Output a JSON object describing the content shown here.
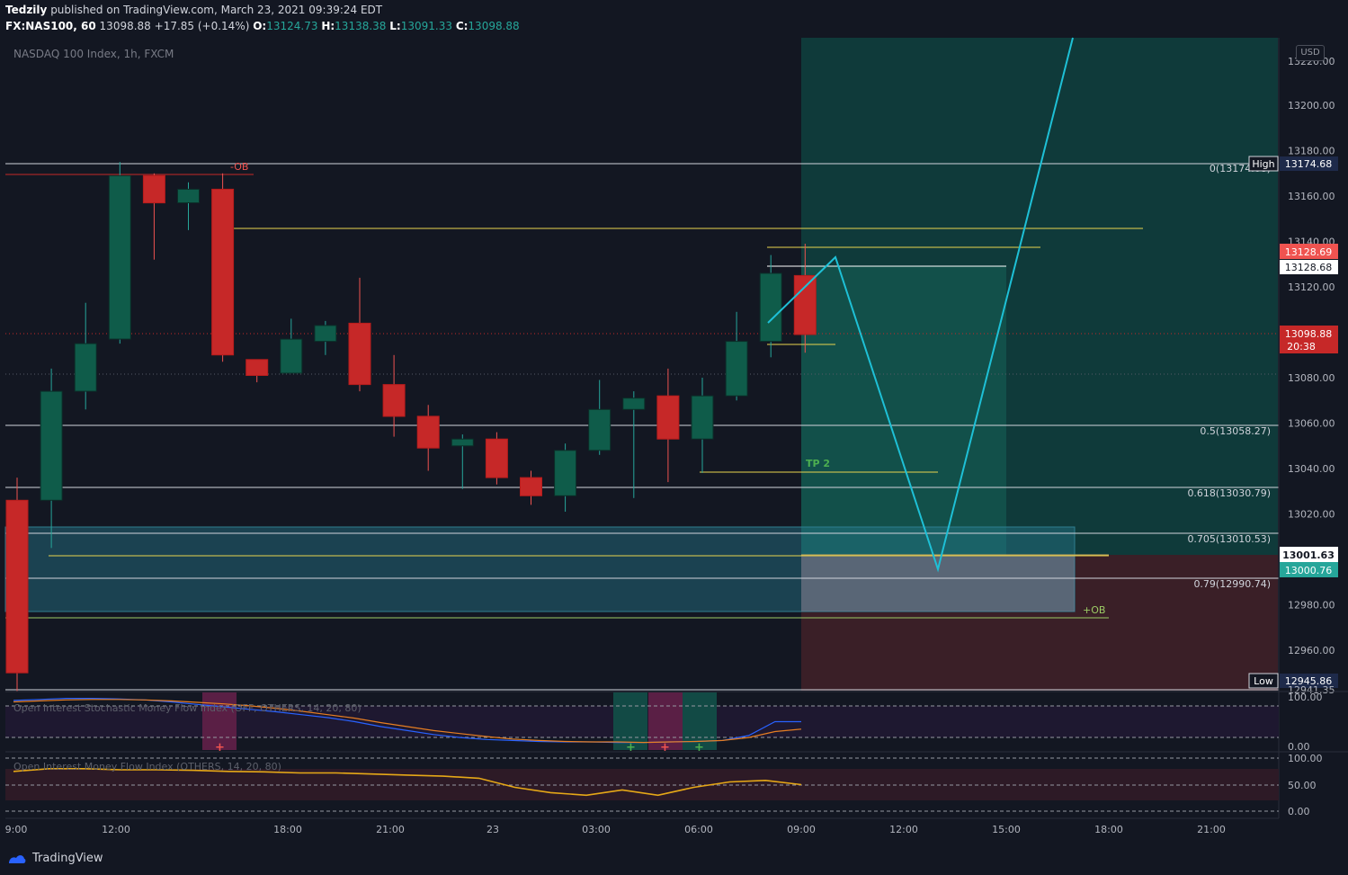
{
  "header": {
    "author": "Tedzily",
    "published_text": "published on TradingView.com, March 23, 2021 09:39:24 EDT",
    "symbol": "FX:NAS100, 60",
    "last": "13098.88",
    "change": "+17.85 (+0.14%)",
    "o_label": "O:",
    "o": "13124.73",
    "h_label": "H:",
    "h": "13138.38",
    "l_label": "L:",
    "l": "13091.33",
    "c_label": "C:",
    "c": "13098.88"
  },
  "legend": {
    "title": "NASDAQ 100 Index, 1h, FXCM"
  },
  "currency_button": "USD",
  "price_axis": {
    "ticks": [
      "13200.00",
      "13180.00",
      "13160.00",
      "13140.00",
      "13120.00",
      "13080.00",
      "13060.00",
      "13040.00",
      "13020.00",
      "12980.00",
      "12960.00"
    ],
    "top_partial": "13220.00",
    "bottom_partial": "12941.35"
  },
  "price_tags": {
    "high_label": "High",
    "high_value": "13174.68",
    "red_tag": "13128.69",
    "white_tag": "13128.68",
    "current": "13098.88",
    "countdown": "20:38",
    "tag_13001": "13001.63",
    "tag_13000": "13000.76",
    "low_label": "Low",
    "low_value": "12945.86"
  },
  "fib_labels": {
    "f0": "0(13174.68)",
    "f05": "0.5(13058.27)",
    "f0618": "0.618(13030.79)",
    "f0705": "0.705(13010.53)",
    "f079": "0.79(12990.74)"
  },
  "annotations": {
    "minus_ob": "-OB",
    "plus_ob": "+OB",
    "tp2": "TP 2"
  },
  "indicators": {
    "ind1_title": "Open Interest Stochastic Money Flow Index (OFF, OTHERS, 14, 20, 80)",
    "ind1_ticks": [
      "100.00",
      "0.00"
    ],
    "ind2_title": "Open Interest Money Flow Index (OTHERS, 14, 20, 80)",
    "ind2_ticks": [
      "100.00",
      "50.00",
      "0.00"
    ]
  },
  "time_axis": [
    "9:00",
    "12:00",
    "18:00",
    "21:00",
    "23",
    "03:00",
    "06:00",
    "09:00",
    "12:00",
    "15:00",
    "18:00",
    "21:00"
  ],
  "footer": {
    "brand": "TradingView"
  },
  "colors": {
    "background": "#131722",
    "bull": "#0f5c4a",
    "bear": "#c62828",
    "cyan": "#1ec0d6",
    "yellow": "#e8d44d",
    "target_zone": "#0f3a3a",
    "stop_zone": "#3a1f27"
  },
  "chart_data": {
    "type": "candlestick",
    "title": "NASDAQ 100 Index, 1h, FXCM",
    "ylim": [
      12941.35,
      13226
    ],
    "candles": [
      {
        "o": 13026,
        "h": 13036,
        "l": 12942,
        "c": 12950
      },
      {
        "o": 13026,
        "h": 13084,
        "l": 13005,
        "c": 13074
      },
      {
        "o": 13074,
        "h": 13113,
        "l": 13066,
        "c": 13095
      },
      {
        "o": 13097,
        "h": 13175,
        "l": 13095,
        "c": 13169
      },
      {
        "o": 13169,
        "h": 13170,
        "l": 13132,
        "c": 13157
      },
      {
        "o": 13157,
        "h": 13166,
        "l": 13145,
        "c": 13163
      },
      {
        "o": 13163,
        "h": 13170,
        "l": 13087,
        "c": 13090
      },
      {
        "o": 13088,
        "h": 13086,
        "l": 13078,
        "c": 13081
      },
      {
        "o": 13082,
        "h": 13106,
        "l": 13082,
        "c": 13097
      },
      {
        "o": 13096,
        "h": 13105,
        "l": 13090,
        "c": 13103
      },
      {
        "o": 13104,
        "h": 13124,
        "l": 13074,
        "c": 13077
      },
      {
        "o": 13077,
        "h": 13090,
        "l": 13054,
        "c": 13063
      },
      {
        "o": 13063,
        "h": 13068,
        "l": 13039,
        "c": 13049
      },
      {
        "o": 13050,
        "h": 13055,
        "l": 13031,
        "c": 13053
      },
      {
        "o": 13053,
        "h": 13056,
        "l": 13033,
        "c": 13036
      },
      {
        "o": 13036,
        "h": 13039,
        "l": 13024,
        "c": 13028
      },
      {
        "o": 13028,
        "h": 13051,
        "l": 13021,
        "c": 13048
      },
      {
        "o": 13048,
        "h": 13079,
        "l": 13046,
        "c": 13066
      },
      {
        "o": 13066,
        "h": 13074,
        "l": 13027,
        "c": 13071
      },
      {
        "o": 13072,
        "h": 13084,
        "l": 13034,
        "c": 13053
      },
      {
        "o": 13053,
        "h": 13080,
        "l": 13038,
        "c": 13072
      },
      {
        "o": 13072,
        "h": 13109,
        "l": 13070,
        "c": 13096
      },
      {
        "o": 13096,
        "h": 13134,
        "l": 13089,
        "c": 13126
      },
      {
        "o": 13125,
        "h": 13139,
        "l": 13091,
        "c": 13099
      }
    ],
    "fib_levels": [
      {
        "ratio": "0",
        "price": 13174.68
      },
      {
        "ratio": "0.5",
        "price": 13058.27
      },
      {
        "ratio": "0.618",
        "price": 13030.79
      },
      {
        "ratio": "0.705",
        "price": 13010.53
      },
      {
        "ratio": "0.79",
        "price": 12990.74
      }
    ],
    "projection_path": [
      [
        13105
      ],
      [
        13132
      ],
      [
        12997
      ],
      [
        13226
      ]
    ],
    "stoch_mfi": [
      93,
      95,
      97,
      97,
      96,
      94,
      90,
      85,
      80,
      75,
      70,
      64,
      58,
      50,
      40,
      32,
      24,
      18,
      14,
      12,
      10,
      9,
      9,
      8,
      8,
      9,
      10,
      12,
      22,
      50,
      50
    ],
    "stoch_signal": [
      90,
      92,
      94,
      95,
      95,
      94,
      92,
      89,
      86,
      82,
      77,
      71,
      64,
      57,
      48,
      40,
      32,
      26,
      20,
      15,
      12,
      10,
      9,
      9,
      8,
      9,
      10,
      12,
      18,
      30,
      35
    ],
    "mfi": [
      75,
      80,
      80,
      78,
      78,
      77,
      75,
      74,
      72,
      72,
      70,
      68,
      66,
      62,
      45,
      35,
      30,
      40,
      30,
      45,
      55,
      58,
      50
    ]
  }
}
